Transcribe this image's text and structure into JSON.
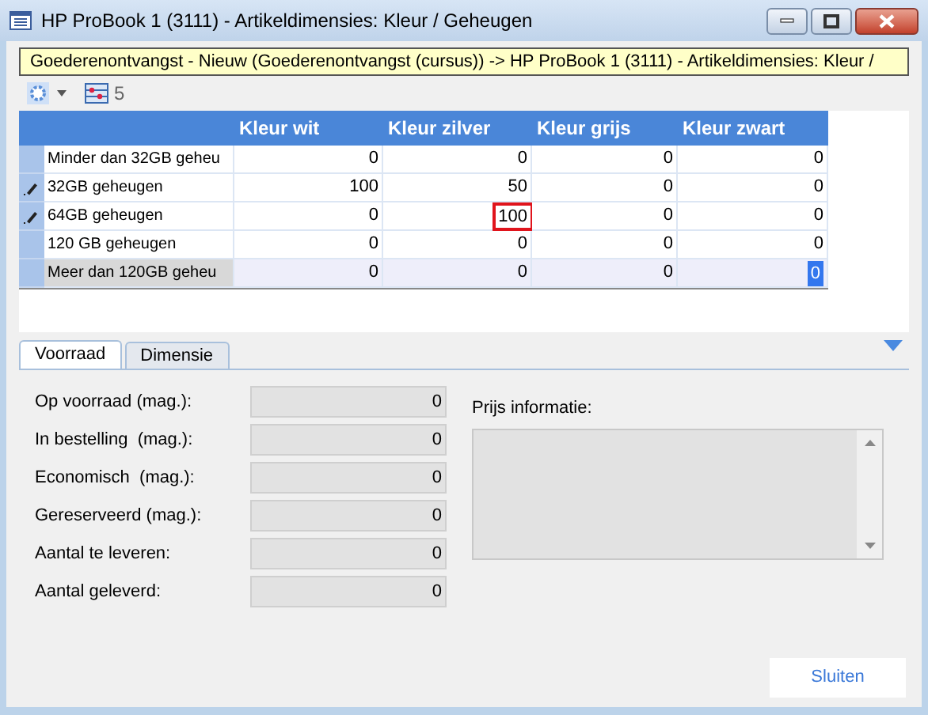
{
  "window": {
    "title": "HP ProBook 1 (3111) - Artikeldimensies: Kleur / Geheugen"
  },
  "breadcrumb": "Goederenontvangst - Nieuw (Goederenontvangst (cursus)) -> HP ProBook 1 (3111) - Artikeldimensies: Kleur /",
  "toolbar": {
    "count": "5"
  },
  "grid": {
    "columns": [
      "Kleur wit",
      "Kleur zilver",
      "Kleur grijs",
      "Kleur zwart"
    ],
    "rows": [
      {
        "name": "Minder dan 32GB geheu",
        "edited": false,
        "selected": false,
        "cells": [
          {
            "value": "0",
            "kind": "plain"
          },
          {
            "value": "0",
            "kind": "plain"
          },
          {
            "value": "0",
            "kind": "plain"
          },
          {
            "value": "0",
            "kind": "plain"
          }
        ]
      },
      {
        "name": "32GB geheugen",
        "edited": true,
        "selected": false,
        "cells": [
          {
            "value": "100",
            "kind": "plain"
          },
          {
            "value": "50",
            "kind": "plain"
          },
          {
            "value": "0",
            "kind": "plain"
          },
          {
            "value": "0",
            "kind": "plain"
          }
        ]
      },
      {
        "name": "64GB geheugen",
        "edited": true,
        "selected": false,
        "cells": [
          {
            "value": "0",
            "kind": "plain"
          },
          {
            "value": "100",
            "kind": "flagged"
          },
          {
            "value": "0",
            "kind": "plain"
          },
          {
            "value": "0",
            "kind": "plain"
          }
        ]
      },
      {
        "name": "120 GB geheugen",
        "edited": false,
        "selected": false,
        "cells": [
          {
            "value": "0",
            "kind": "plain"
          },
          {
            "value": "0",
            "kind": "plain"
          },
          {
            "value": "0",
            "kind": "plain"
          },
          {
            "value": "0",
            "kind": "plain"
          }
        ]
      },
      {
        "name": "Meer dan 120GB geheu",
        "edited": false,
        "selected": true,
        "cells": [
          {
            "value": "0",
            "kind": "plain"
          },
          {
            "value": "0",
            "kind": "plain"
          },
          {
            "value": "0",
            "kind": "plain"
          },
          {
            "value": "0",
            "kind": "editing"
          }
        ]
      }
    ]
  },
  "tabs": [
    {
      "label": "Voorraad",
      "selected": true
    },
    {
      "label": "Dimensie",
      "selected": false
    }
  ],
  "fields": [
    {
      "label": "Op voorraad (mag.):",
      "value": "0"
    },
    {
      "label": "In bestelling  (mag.):",
      "value": "0"
    },
    {
      "label": "Economisch  (mag.):",
      "value": "0"
    },
    {
      "label": "Gereserveerd (mag.):",
      "value": "0"
    },
    {
      "label": "Aantal te leveren:",
      "value": "0"
    },
    {
      "label": "Aantal geleverd:",
      "value": "0"
    }
  ],
  "price_info": {
    "label": "Prijs informatie:"
  },
  "buttons": [
    {
      "label": "Sluiten"
    }
  ]
}
